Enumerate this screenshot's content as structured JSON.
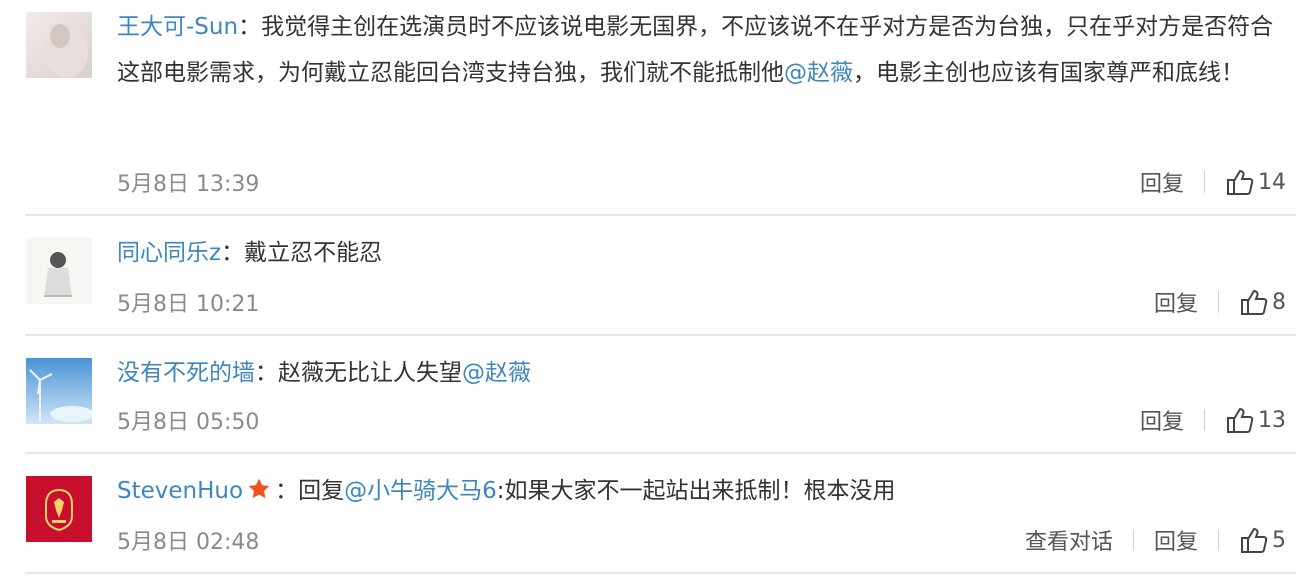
{
  "comments": [
    {
      "user": "王大可-Sun",
      "colon": "：",
      "text1": "我觉得主创在选演员时不应该说电影无国界，不应该说不在乎对方是否为台独，只在乎对方是否符合这部电影需求，为何戴立忍能回台湾支持台独，我们就不能抵制他",
      "mention": "@赵薇",
      "text2": "，电影主创也应该有国家尊严和底线！",
      "time": "5月8日 13:39",
      "reply": "回复",
      "likes": "14"
    },
    {
      "user": "同心同乐z",
      "colon": "：",
      "text1": "戴立忍不能忍",
      "time": "5月8日 10:21",
      "reply": "回复",
      "likes": "8"
    },
    {
      "user": "没有不死的墙",
      "colon": "：",
      "text1": "赵薇无比让人失望",
      "mention": "@赵薇",
      "time": "5月8日 05:50",
      "reply": "回复",
      "likes": "13"
    },
    {
      "user": "StevenHuo",
      "colon": "：",
      "pre": "回复",
      "mention": "@小牛骑大马6",
      "text1": ":如果大家不一起站出来抵制！根本没用",
      "time": "5月8日 02:48",
      "view_conversation": "查看对话",
      "reply": "回复",
      "likes": "5"
    }
  ],
  "icons": {
    "like": "thumbs-up-icon",
    "badge": "star-icon"
  },
  "colors": {
    "link": "#3d86bf",
    "text": "#333333",
    "meta": "#8a8a8a",
    "badge": "#f0541e"
  }
}
